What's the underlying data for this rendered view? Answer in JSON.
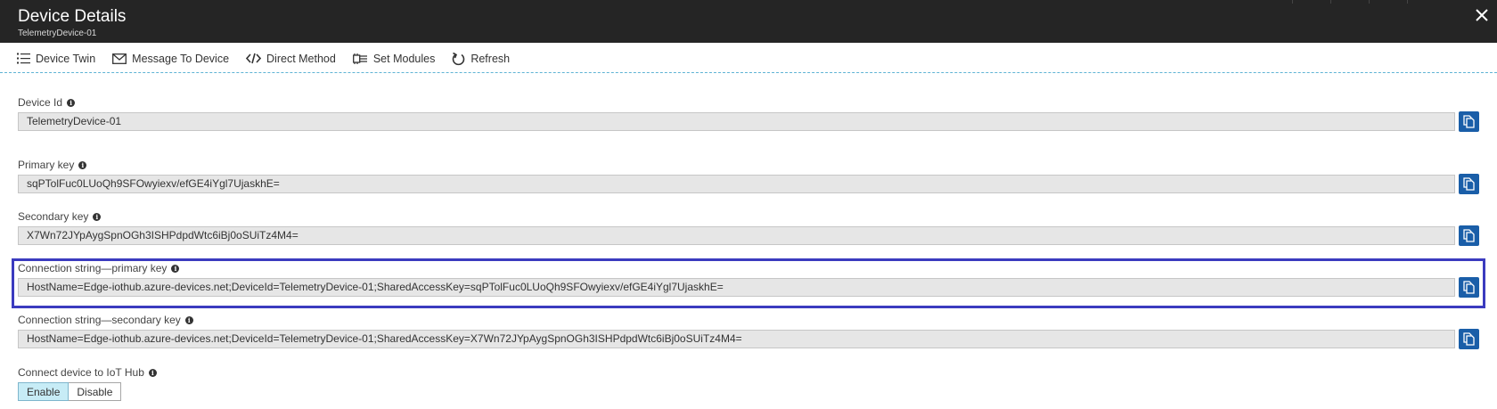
{
  "header": {
    "title": "Device Details",
    "subtitle": "TelemetryDevice-01"
  },
  "toolbar": {
    "device_twin": "Device Twin",
    "message_to_device": "Message To Device",
    "direct_method": "Direct Method",
    "set_modules": "Set Modules",
    "refresh": "Refresh"
  },
  "fields": {
    "device_id": {
      "label": "Device Id",
      "value": "TelemetryDevice-01"
    },
    "primary_key": {
      "label": "Primary key",
      "value": "sqPTolFuc0LUoQh9SFOwyiexv/efGE4iYgl7UjaskhE="
    },
    "secondary_key": {
      "label": "Secondary key",
      "value": "X7Wn72JYpAygSpnOGh3ISHPdpdWtc6iBj0oSUiTz4M4="
    },
    "conn_primary": {
      "label": "Connection string—primary key",
      "value": "HostName=Edge-iothub.azure-devices.net;DeviceId=TelemetryDevice-01;SharedAccessKey=sqPTolFuc0LUoQh9SFOwyiexv/efGE4iYgl7UjaskhE="
    },
    "conn_secondary": {
      "label": "Connection string—secondary key",
      "value": "HostName=Edge-iothub.azure-devices.net;DeviceId=TelemetryDevice-01;SharedAccessKey=X7Wn72JYpAygSpnOGh3ISHPdpdWtc6iBj0oSUiTz4M4="
    }
  },
  "connect": {
    "label": "Connect device to IoT Hub",
    "enable": "Enable",
    "disable": "Disable",
    "selected": "Enable"
  },
  "colors": {
    "header_bg": "#252525",
    "accent": "#1a5ea8",
    "highlight_border": "#3b3bbf",
    "toggle_selected": "#c7ecf6"
  },
  "icons": [
    "close-icon",
    "list-icon",
    "envelope-icon",
    "code-icon",
    "modules-icon",
    "refresh-icon",
    "info-icon",
    "copy-icon"
  ]
}
